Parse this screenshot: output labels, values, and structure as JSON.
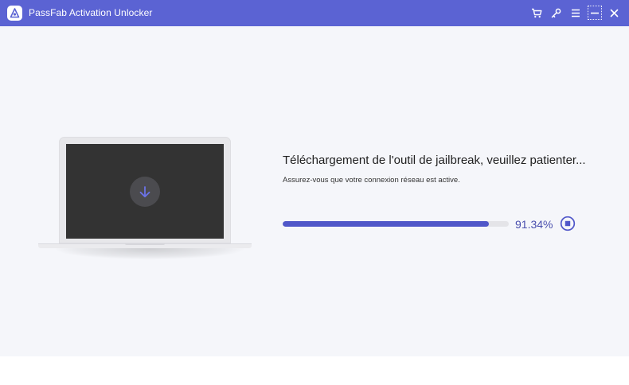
{
  "window": {
    "title": "PassFab Activation Unlocker",
    "accent_color": "#5b63d3",
    "controls": [
      "cart-icon",
      "key-icon",
      "menu-icon",
      "minimize-icon",
      "close-icon"
    ]
  },
  "main": {
    "heading": "Téléchargement de l'outil de jailbreak, veuillez patienter...",
    "subtext": "Assurez-vous que votre connexion réseau est active.",
    "progress_percent": 91.34,
    "progress_label": "91.34%",
    "progress_color": "#5057c9",
    "illustration": "laptop-with-download-icon"
  }
}
